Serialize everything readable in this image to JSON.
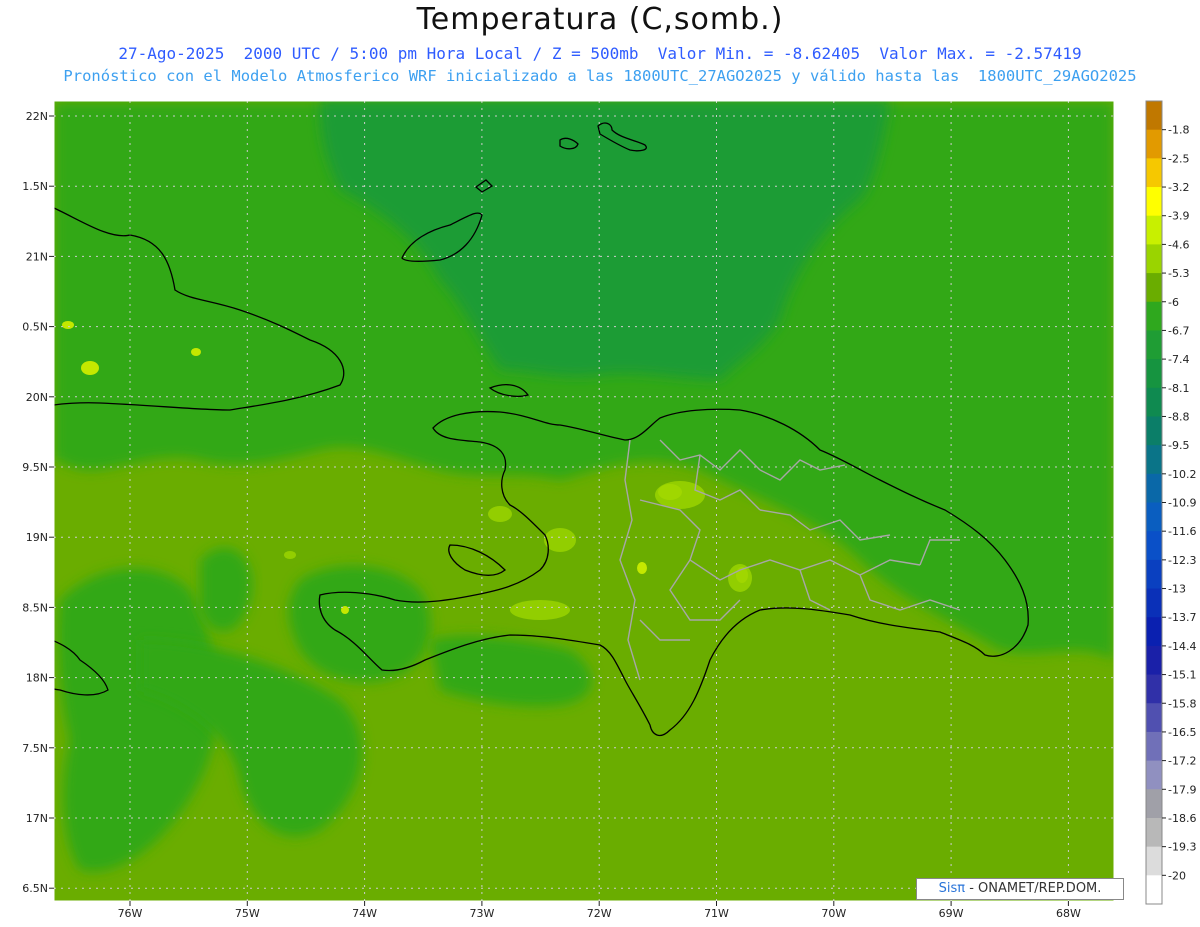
{
  "header": {
    "title": "Temperatura (C,somb.)",
    "line1": "27-Ago-2025  2000 UTC / 5:00 pm Hora Local / Z = 500mb  Valor Min. = -8.62405  Valor Max. = -2.57419",
    "line2": "Pronóstico con el Modelo Atmosferico WRF inicializado a las 1800UTC_27AGO2025 y válido hasta las  1800UTC_29AGO2025"
  },
  "map": {
    "lat_ticks": [
      "22N",
      "1.5N",
      "21N",
      "0.5N",
      "20N",
      "9.5N",
      "19N",
      "8.5N",
      "18N",
      "7.5N",
      "17N",
      "6.5N"
    ],
    "lon_ticks": [
      "76W",
      "75W",
      "74W",
      "73W",
      "72W",
      "71W",
      "70W",
      "69W",
      "68W"
    ],
    "colors": {
      "ocean_south": "#6aad00",
      "ocean_green": "#32a818",
      "north_dark": "#1e9c34",
      "warm_yellow": "#c4e800",
      "coast": "#000000",
      "province_border": "#a7a7a7"
    }
  },
  "colorbar": {
    "labels": [
      "-1.8",
      "-2.5",
      "-3.2",
      "-3.9",
      "-4.6",
      "-5.3",
      "-6",
      "-6.7",
      "-7.4",
      "-8.1",
      "-8.8",
      "-9.5",
      "-10.2",
      "-10.9",
      "-11.6",
      "-12.3",
      "-13",
      "-13.7",
      "-14.4",
      "-15.1",
      "-15.8",
      "-16.5",
      "-17.2",
      "-17.9",
      "-18.6",
      "-19.3",
      "-20"
    ],
    "colors": [
      "#c07800",
      "#e29a00",
      "#f6c800",
      "#ffff00",
      "#c8f000",
      "#9ad400",
      "#6aad00",
      "#2fa81e",
      "#1f9d34",
      "#169440",
      "#0f8a50",
      "#0b7e68",
      "#0a7488",
      "#0a68a8",
      "#0a5ec0",
      "#0a50c8",
      "#0a40c0",
      "#0a30b8",
      "#0a20b0",
      "#1a20a8",
      "#3030a8",
      "#5050b0",
      "#7070b8",
      "#9090c0",
      "#a0a0a8",
      "#b8b8b8",
      "#dcdcdc",
      "#ffffff"
    ]
  },
  "credit": {
    "brand": "Sisπ",
    "text": "- ONAMET/REP.DOM."
  }
}
